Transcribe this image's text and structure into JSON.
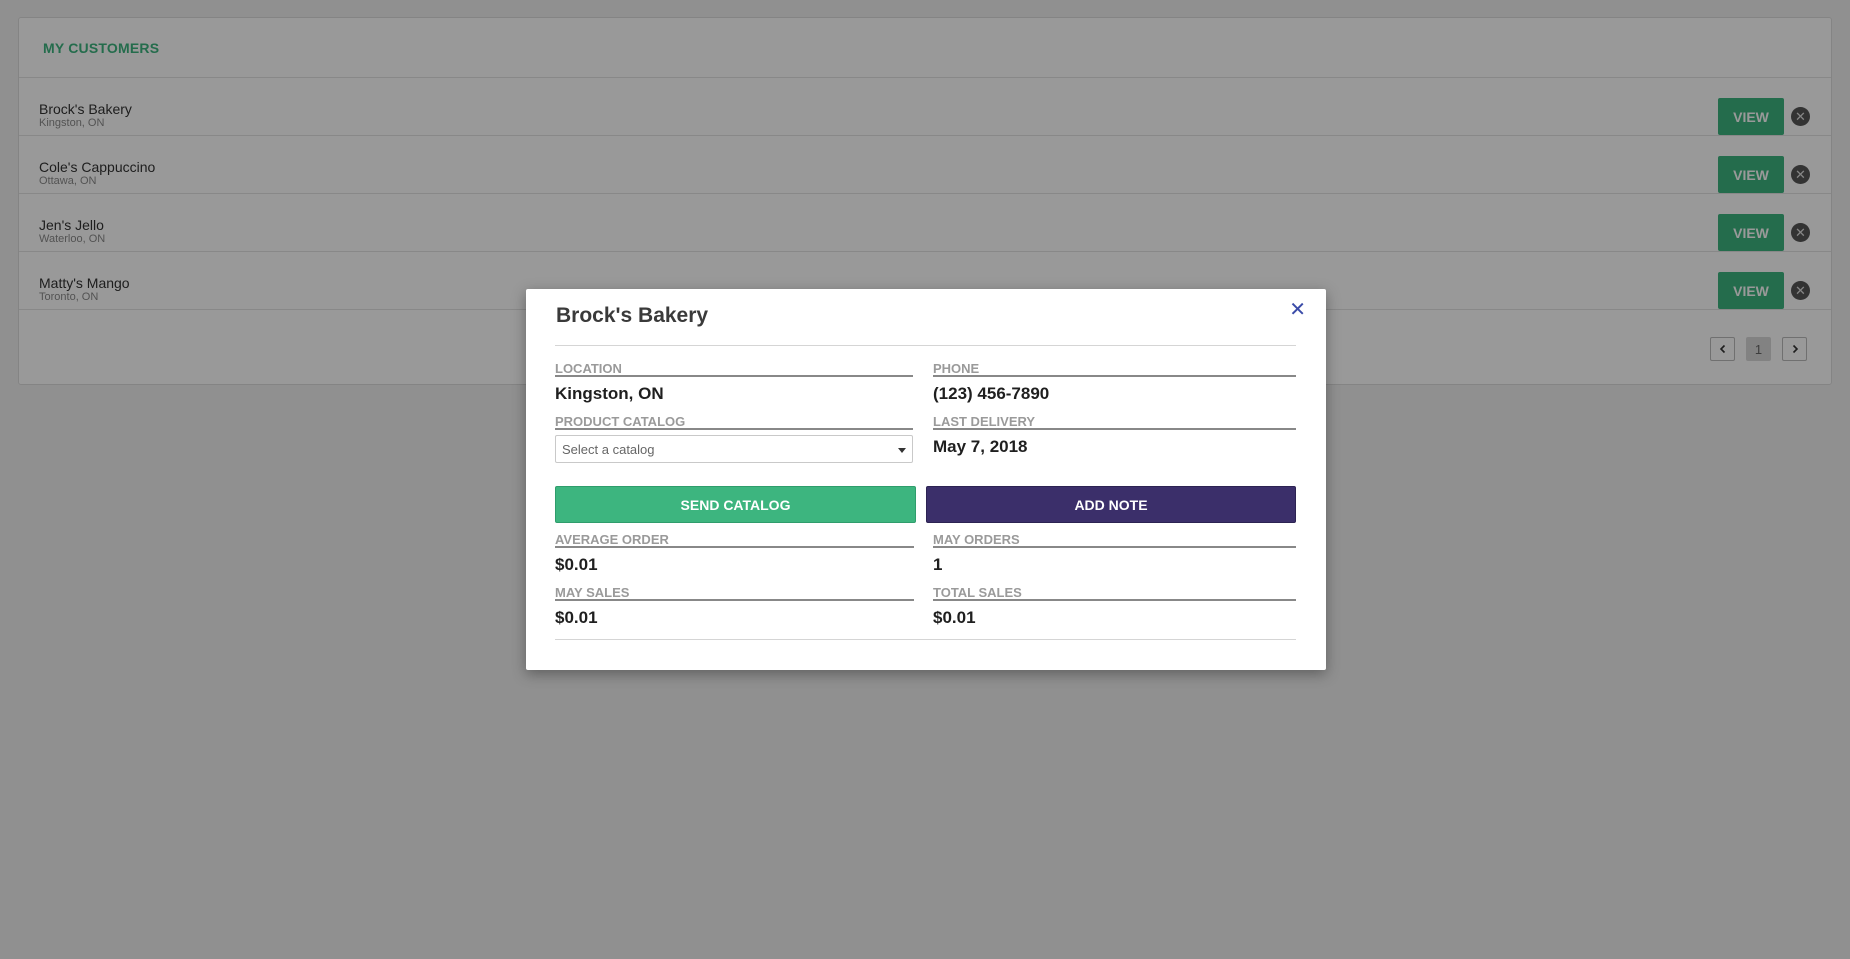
{
  "customers_panel": {
    "title": "MY CUSTOMERS",
    "view_label": "VIEW",
    "remove_icon": "close-circle-icon",
    "items": [
      {
        "name": "Brock's Bakery",
        "location": "Kingston, ON"
      },
      {
        "name": "Cole's Cappuccino",
        "location": "Ottawa, ON"
      },
      {
        "name": "Jen's Jello",
        "location": "Waterloo, ON"
      },
      {
        "name": "Matty's Mango",
        "location": "Toronto, ON"
      }
    ],
    "pagination": {
      "prev_icon": "chevron-left-icon",
      "current_page": "1",
      "next_icon": "chevron-right-icon"
    }
  },
  "modal": {
    "title": "Brock's Bakery",
    "close_icon": "close-icon",
    "location": {
      "label": "LOCATION",
      "value": "Kingston, ON"
    },
    "phone": {
      "label": "PHONE",
      "value": "(123) 456-7890"
    },
    "product_catalog": {
      "label": "PRODUCT CATALOG",
      "placeholder": "Select a catalog"
    },
    "last_delivery": {
      "label": "LAST DELIVERY",
      "value": "May 7, 2018"
    },
    "send_catalog_label": "SEND CATALOG",
    "add_note_label": "ADD NOTE",
    "average_order": {
      "label": "AVERAGE ORDER",
      "value": "$0.01"
    },
    "may_orders": {
      "label": "MAY ORDERS",
      "value": "1"
    },
    "may_sales": {
      "label": "MAY SALES",
      "value": "$0.01"
    },
    "total_sales": {
      "label": "TOTAL SALES",
      "value": "$0.01"
    }
  },
  "colors": {
    "accent_green": "#3db57f",
    "accent_purple": "#3b2f6a",
    "close_blue": "#3a4ba8"
  }
}
